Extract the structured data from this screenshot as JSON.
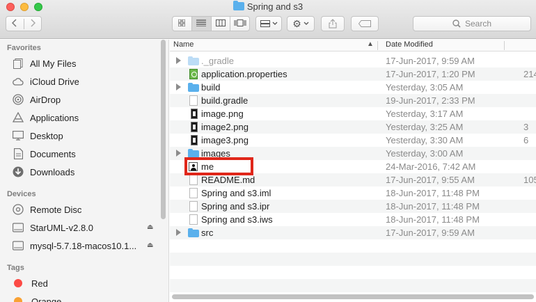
{
  "window": {
    "title": "Spring and s3"
  },
  "toolbar": {
    "back_icon": "chevron-left",
    "forward_icon": "chevron-right",
    "search_placeholder": "Search"
  },
  "sidebar": {
    "favorites_heading": "Favorites",
    "favorites": [
      {
        "label": "All My Files",
        "icon": "all-files-icon"
      },
      {
        "label": "iCloud Drive",
        "icon": "cloud-icon"
      },
      {
        "label": "AirDrop",
        "icon": "airdrop-icon"
      },
      {
        "label": "Applications",
        "icon": "applications-icon"
      },
      {
        "label": "Desktop",
        "icon": "desktop-icon"
      },
      {
        "label": "Documents",
        "icon": "documents-icon"
      },
      {
        "label": "Downloads",
        "icon": "downloads-icon"
      }
    ],
    "devices_heading": "Devices",
    "devices": [
      {
        "label": "Remote Disc",
        "icon": "disc-icon"
      },
      {
        "label": "StarUML-v2.8.0",
        "icon": "drive-icon"
      },
      {
        "label": "mysql-5.7.18-macos10.1...",
        "icon": "drive-icon"
      }
    ],
    "tags_heading": "Tags",
    "tags": [
      {
        "label": "Red",
        "color": "#fc4a45"
      },
      {
        "label": "Orange",
        "color": "#f9a133"
      }
    ]
  },
  "list": {
    "col_name": "Name",
    "col_date": "Date Modified",
    "rows": [
      {
        "name": "._gradle",
        "date": "17-Jun-2017, 9:59 AM",
        "size": ""
      },
      {
        "name": "application.properties",
        "date": "17-Jun-2017, 1:20 PM",
        "size": "214"
      },
      {
        "name": "build",
        "date": "Yesterday, 3:05 AM",
        "size": ""
      },
      {
        "name": "build.gradle",
        "date": "19-Jun-2017, 2:33 PM",
        "size": ""
      },
      {
        "name": "image.png",
        "date": "Yesterday, 3:17 AM",
        "size": ""
      },
      {
        "name": "image2.png",
        "date": "Yesterday, 3:25 AM",
        "size": "3"
      },
      {
        "name": "image3.png",
        "date": "Yesterday, 3:30 AM",
        "size": "6"
      },
      {
        "name": "images",
        "date": "Yesterday, 3:00 AM",
        "size": ""
      },
      {
        "name": "me",
        "date": "24-Mar-2016, 7:42 AM",
        "size": ""
      },
      {
        "name": "README.md",
        "date": "17-Jun-2017, 9:55 AM",
        "size": "105"
      },
      {
        "name": "Spring and s3.iml",
        "date": "18-Jun-2017, 11:48 PM",
        "size": ""
      },
      {
        "name": "Spring and s3.ipr",
        "date": "18-Jun-2017, 11:48 PM",
        "size": ""
      },
      {
        "name": "Spring and s3.iws",
        "date": "18-Jun-2017, 11:48 PM",
        "size": ""
      },
      {
        "name": "src",
        "date": "17-Jun-2017, 9:59 AM",
        "size": ""
      }
    ]
  }
}
